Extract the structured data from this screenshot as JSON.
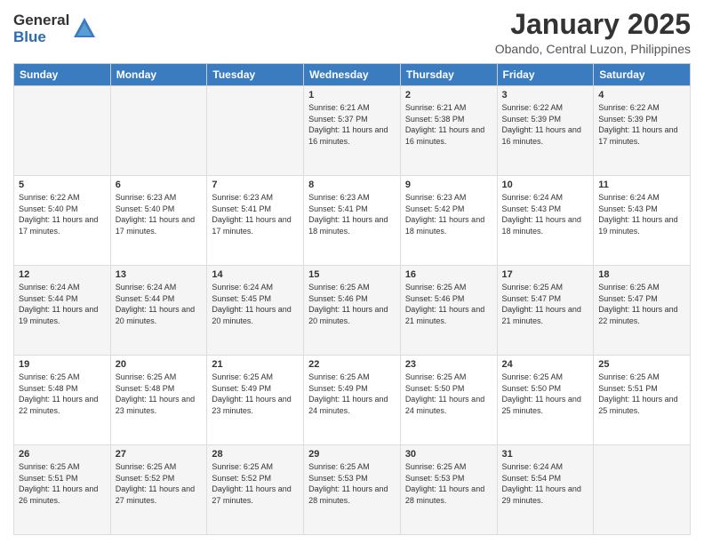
{
  "header": {
    "logo_general": "General",
    "logo_blue": "Blue",
    "month_title": "January 2025",
    "location": "Obando, Central Luzon, Philippines"
  },
  "days_of_week": [
    "Sunday",
    "Monday",
    "Tuesday",
    "Wednesday",
    "Thursday",
    "Friday",
    "Saturday"
  ],
  "weeks": [
    [
      {
        "day": "",
        "sunrise": "",
        "sunset": "",
        "daylight": ""
      },
      {
        "day": "",
        "sunrise": "",
        "sunset": "",
        "daylight": ""
      },
      {
        "day": "",
        "sunrise": "",
        "sunset": "",
        "daylight": ""
      },
      {
        "day": "1",
        "sunrise": "6:21 AM",
        "sunset": "5:37 PM",
        "daylight": "11 hours and 16 minutes."
      },
      {
        "day": "2",
        "sunrise": "6:21 AM",
        "sunset": "5:38 PM",
        "daylight": "11 hours and 16 minutes."
      },
      {
        "day": "3",
        "sunrise": "6:22 AM",
        "sunset": "5:39 PM",
        "daylight": "11 hours and 16 minutes."
      },
      {
        "day": "4",
        "sunrise": "6:22 AM",
        "sunset": "5:39 PM",
        "daylight": "11 hours and 17 minutes."
      }
    ],
    [
      {
        "day": "5",
        "sunrise": "6:22 AM",
        "sunset": "5:40 PM",
        "daylight": "11 hours and 17 minutes."
      },
      {
        "day": "6",
        "sunrise": "6:23 AM",
        "sunset": "5:40 PM",
        "daylight": "11 hours and 17 minutes."
      },
      {
        "day": "7",
        "sunrise": "6:23 AM",
        "sunset": "5:41 PM",
        "daylight": "11 hours and 17 minutes."
      },
      {
        "day": "8",
        "sunrise": "6:23 AM",
        "sunset": "5:41 PM",
        "daylight": "11 hours and 18 minutes."
      },
      {
        "day": "9",
        "sunrise": "6:23 AM",
        "sunset": "5:42 PM",
        "daylight": "11 hours and 18 minutes."
      },
      {
        "day": "10",
        "sunrise": "6:24 AM",
        "sunset": "5:43 PM",
        "daylight": "11 hours and 18 minutes."
      },
      {
        "day": "11",
        "sunrise": "6:24 AM",
        "sunset": "5:43 PM",
        "daylight": "11 hours and 19 minutes."
      }
    ],
    [
      {
        "day": "12",
        "sunrise": "6:24 AM",
        "sunset": "5:44 PM",
        "daylight": "11 hours and 19 minutes."
      },
      {
        "day": "13",
        "sunrise": "6:24 AM",
        "sunset": "5:44 PM",
        "daylight": "11 hours and 20 minutes."
      },
      {
        "day": "14",
        "sunrise": "6:24 AM",
        "sunset": "5:45 PM",
        "daylight": "11 hours and 20 minutes."
      },
      {
        "day": "15",
        "sunrise": "6:25 AM",
        "sunset": "5:46 PM",
        "daylight": "11 hours and 20 minutes."
      },
      {
        "day": "16",
        "sunrise": "6:25 AM",
        "sunset": "5:46 PM",
        "daylight": "11 hours and 21 minutes."
      },
      {
        "day": "17",
        "sunrise": "6:25 AM",
        "sunset": "5:47 PM",
        "daylight": "11 hours and 21 minutes."
      },
      {
        "day": "18",
        "sunrise": "6:25 AM",
        "sunset": "5:47 PM",
        "daylight": "11 hours and 22 minutes."
      }
    ],
    [
      {
        "day": "19",
        "sunrise": "6:25 AM",
        "sunset": "5:48 PM",
        "daylight": "11 hours and 22 minutes."
      },
      {
        "day": "20",
        "sunrise": "6:25 AM",
        "sunset": "5:48 PM",
        "daylight": "11 hours and 23 minutes."
      },
      {
        "day": "21",
        "sunrise": "6:25 AM",
        "sunset": "5:49 PM",
        "daylight": "11 hours and 23 minutes."
      },
      {
        "day": "22",
        "sunrise": "6:25 AM",
        "sunset": "5:49 PM",
        "daylight": "11 hours and 24 minutes."
      },
      {
        "day": "23",
        "sunrise": "6:25 AM",
        "sunset": "5:50 PM",
        "daylight": "11 hours and 24 minutes."
      },
      {
        "day": "24",
        "sunrise": "6:25 AM",
        "sunset": "5:50 PM",
        "daylight": "11 hours and 25 minutes."
      },
      {
        "day": "25",
        "sunrise": "6:25 AM",
        "sunset": "5:51 PM",
        "daylight": "11 hours and 25 minutes."
      }
    ],
    [
      {
        "day": "26",
        "sunrise": "6:25 AM",
        "sunset": "5:51 PM",
        "daylight": "11 hours and 26 minutes."
      },
      {
        "day": "27",
        "sunrise": "6:25 AM",
        "sunset": "5:52 PM",
        "daylight": "11 hours and 27 minutes."
      },
      {
        "day": "28",
        "sunrise": "6:25 AM",
        "sunset": "5:52 PM",
        "daylight": "11 hours and 27 minutes."
      },
      {
        "day": "29",
        "sunrise": "6:25 AM",
        "sunset": "5:53 PM",
        "daylight": "11 hours and 28 minutes."
      },
      {
        "day": "30",
        "sunrise": "6:25 AM",
        "sunset": "5:53 PM",
        "daylight": "11 hours and 28 minutes."
      },
      {
        "day": "31",
        "sunrise": "6:24 AM",
        "sunset": "5:54 PM",
        "daylight": "11 hours and 29 minutes."
      },
      {
        "day": "",
        "sunrise": "",
        "sunset": "",
        "daylight": ""
      }
    ]
  ],
  "labels": {
    "sunrise_prefix": "Sunrise: ",
    "sunset_prefix": "Sunset: ",
    "daylight_prefix": "Daylight: "
  }
}
